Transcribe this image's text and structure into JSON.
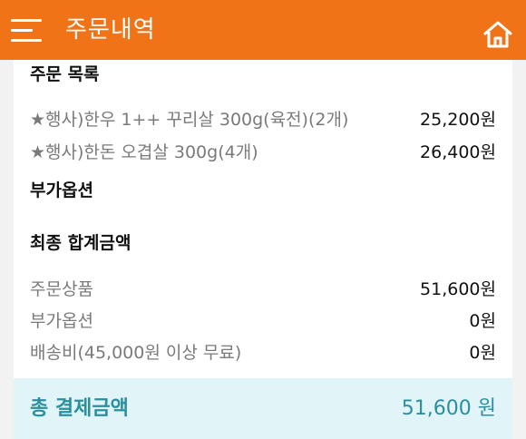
{
  "header": {
    "title": "주문내역",
    "background_color": "#f07318",
    "menu_icon": "hamburger-menu-icon",
    "home_icon": "home-icon"
  },
  "order_list": {
    "title": "주문 목록",
    "items": [
      {
        "name": "★행사)한우 1++ 꾸리살 300g(육전)(2개)",
        "price": "25,200원"
      },
      {
        "name": "★행사)한돈 오겹살 300g(4개)",
        "price": "26,400원"
      }
    ]
  },
  "options": {
    "title": "부가옵션"
  },
  "summary": {
    "title": "최종 합계금액",
    "rows": [
      {
        "label": "주문상품",
        "value": "51,600원"
      },
      {
        "label": "부가옵션",
        "value": "0원"
      },
      {
        "label": "배송비(45,000원 이상 무료)",
        "value": "0원"
      }
    ]
  },
  "total": {
    "label": "총 결제금액",
    "value": "51,600 원",
    "color": "#2a8f9f",
    "background_color": "#e1f4f7"
  }
}
